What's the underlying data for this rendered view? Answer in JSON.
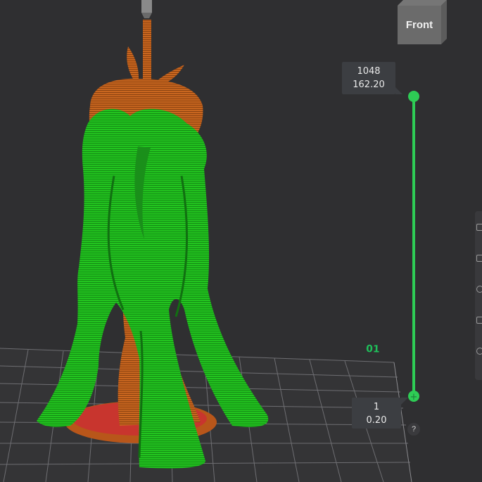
{
  "view_cube": {
    "label": "Front"
  },
  "layer_slider": {
    "top": {
      "layer": "1048",
      "height": "162.20"
    },
    "bottom": {
      "layer": "1",
      "height": "0.20"
    },
    "color": "#2ecc55"
  },
  "bed": {
    "label": "01"
  },
  "help": {
    "label": "?"
  },
  "colors": {
    "background": "#2f2f31",
    "support_green": "#22cc22",
    "model_orange": "#c8661f",
    "base_red": "#c8352e"
  }
}
